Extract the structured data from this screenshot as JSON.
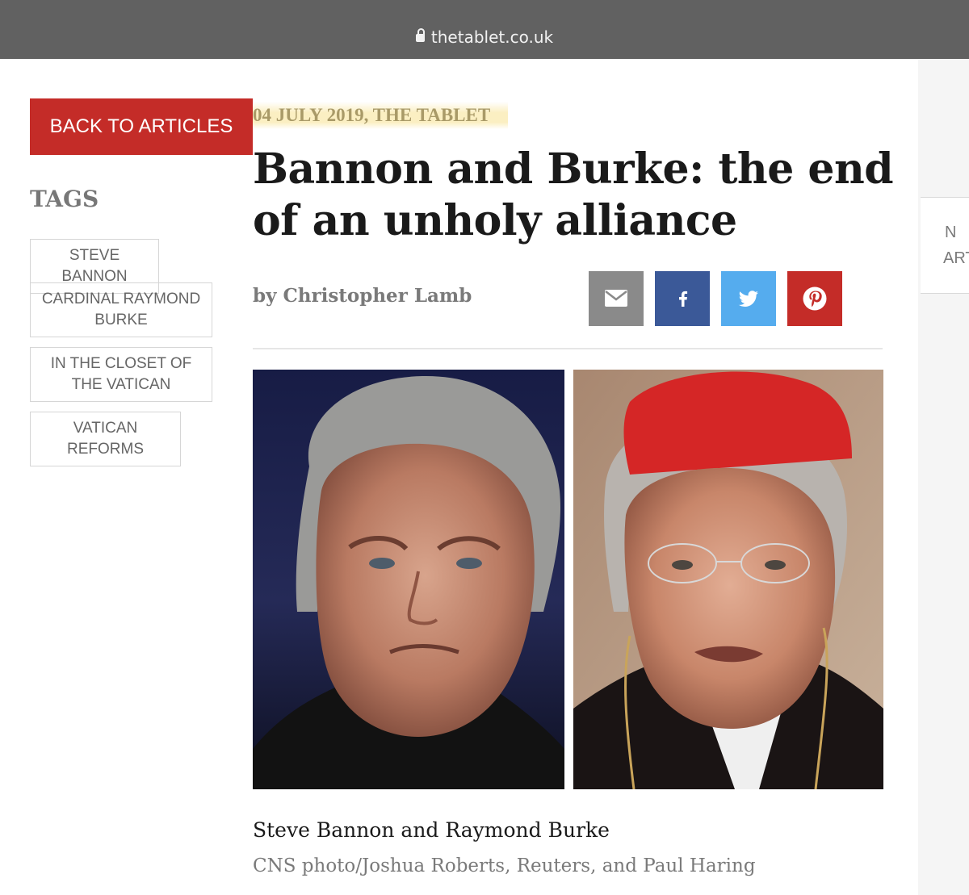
{
  "browser": {
    "url": "thetablet.co.uk"
  },
  "sidebar": {
    "back_label": "BACK TO ARTICLES",
    "tags_heading": "TAGS",
    "tags": [
      {
        "label": "STEVE BANNON"
      },
      {
        "label": "CARDINAL RAYMOND BURKE"
      },
      {
        "label": "IN THE CLOSET OF THE VATICAN"
      },
      {
        "label": "VATICAN REFORMS"
      }
    ]
  },
  "article": {
    "dateline": "04 JULY 2019, THE TABLET",
    "headline": "Bannon and Burke: the end of an unholy alliance",
    "byline": "by Christopher Lamb",
    "share": [
      {
        "icon": "mail-icon",
        "color": "#8a8a8a"
      },
      {
        "icon": "facebook-icon",
        "color": "#3b5998"
      },
      {
        "icon": "twitter-icon",
        "color": "#55acee"
      },
      {
        "icon": "pinterest-icon",
        "color": "#c42c28"
      }
    ],
    "caption": "Steve Bannon and Raymond Burke",
    "credit": "CNS photo/Joshua Roberts, Reuters, and Paul Haring"
  },
  "right_panel": {
    "line1": "N",
    "line2": "ART"
  },
  "colors": {
    "accent": "#c42c28",
    "browser_bar": "#616161",
    "highlight": "#fbefc2"
  }
}
